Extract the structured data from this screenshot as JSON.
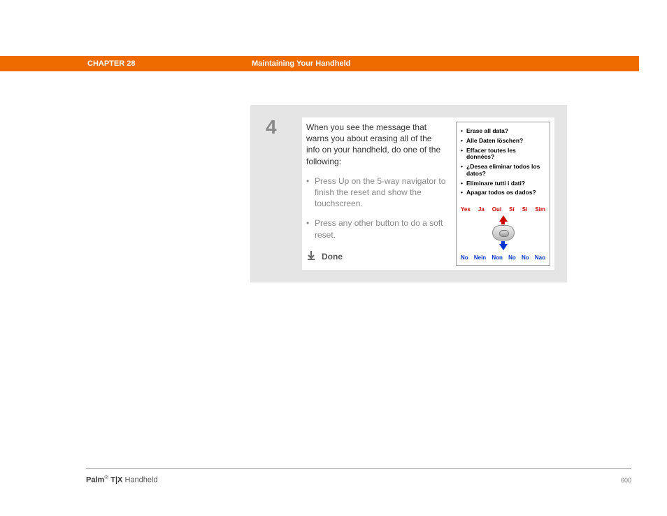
{
  "header": {
    "chapter_label": "CHAPTER 28",
    "chapter_title": "Maintaining Your Handheld"
  },
  "step": {
    "number": "4",
    "intro": "When you see the message that warns you about erasing all of the info on your handheld, do one of the following:",
    "bullets": [
      "Press Up on the 5-way navigator to finish the reset and show the touchscreen.",
      "Press any other button to do a soft reset."
    ],
    "done_label": "Done"
  },
  "device_screen": {
    "messages": [
      "Erase all data?",
      "Alle Daten löschen?",
      "Effacer toutes les données?",
      "¿Desea eliminar todos los datos?",
      "Eliminare tutti i dati?",
      "Apagar todos os dados?"
    ],
    "yes_row": [
      "Yes",
      "Ja",
      "Oui",
      "Sí",
      "Sì",
      "Sim"
    ],
    "no_row": [
      "No",
      "Nein",
      "Non",
      "No",
      "No",
      "Nao"
    ]
  },
  "footer": {
    "brand": "Palm",
    "model": " T|X",
    "suffix": " Handheld",
    "page": "600"
  }
}
